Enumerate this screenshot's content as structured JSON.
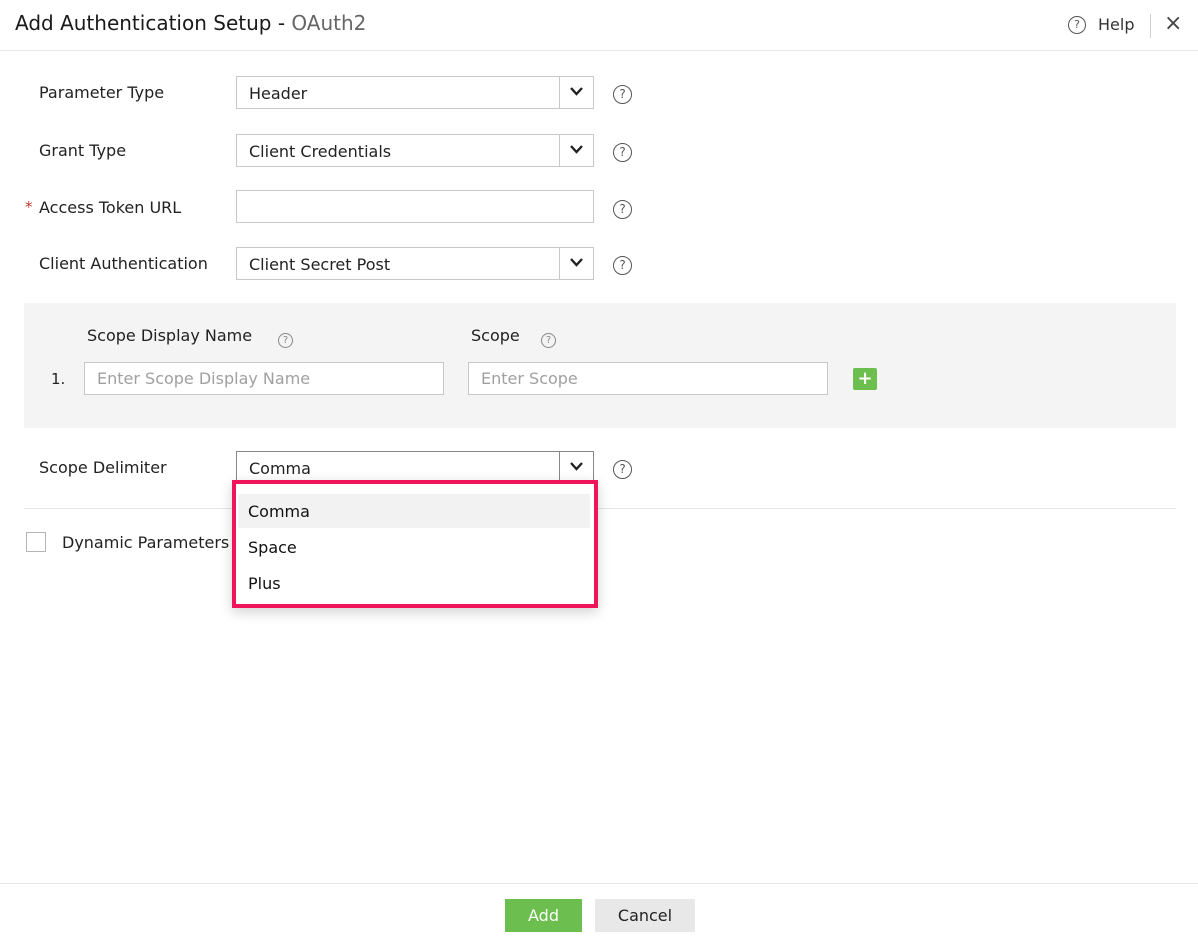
{
  "header": {
    "title_main": "Add Authentication Setup",
    "title_sep": " - ",
    "title_sub": "OAuth2",
    "help_label": "Help",
    "help_glyph": "?",
    "close_glyph": "×"
  },
  "form": {
    "parameter_type": {
      "label": "Parameter Type",
      "value": "Header"
    },
    "grant_type": {
      "label": "Grant Type",
      "value": "Client Credentials"
    },
    "access_token_url": {
      "required_mark": "*",
      "label": "Access Token URL",
      "value": ""
    },
    "client_authentication": {
      "label": "Client Authentication",
      "value": "Client Secret Post"
    },
    "scope_delimiter": {
      "label": "Scope Delimiter",
      "value": "Comma"
    },
    "help_glyph": "?"
  },
  "scopes": {
    "display_name_header": "Scope Display Name",
    "scope_header": "Scope",
    "row_number": "1.",
    "display_name_placeholder": "Enter Scope Display Name",
    "scope_placeholder": "Enter Scope",
    "add_glyph": "+"
  },
  "dynamic_parameters": {
    "label": "Dynamic Parameters",
    "checked": false
  },
  "dropdown": {
    "options": [
      "Comma",
      "Space",
      "Plus"
    ],
    "selected": "Comma"
  },
  "footer": {
    "add_label": "Add",
    "cancel_label": "Cancel"
  },
  "colors": {
    "accent_green": "#6cbf4e",
    "highlight_border": "#f0155a"
  }
}
